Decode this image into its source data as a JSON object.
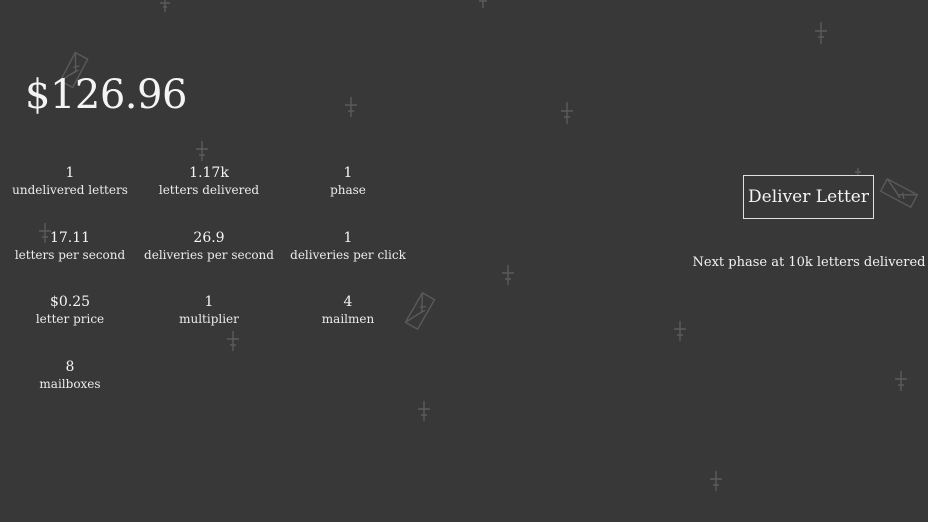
{
  "money": "$126.96",
  "stats": [
    {
      "value": "1",
      "label": "undelivered letters"
    },
    {
      "value": "1.17k",
      "label": "letters delivered"
    },
    {
      "value": "1",
      "label": "phase"
    },
    {
      "value": "17.11",
      "label": "letters per second"
    },
    {
      "value": "26.9",
      "label": "deliveries per second"
    },
    {
      "value": "1",
      "label": "deliveries per click"
    },
    {
      "value": "$0.25",
      "label": "letter price"
    },
    {
      "value": "1",
      "label": "multiplier"
    },
    {
      "value": "4",
      "label": "mailmen"
    },
    {
      "value": "8",
      "label": "mailboxes"
    }
  ],
  "deliver_button": {
    "label": "Deliver Letter"
  },
  "next_phase_text": "Next phase at 10k letters delivered",
  "colors": {
    "background": "#383838",
    "text": "#f2f2f2",
    "decoration": "#5a5a5a"
  },
  "decorations": {
    "sparkle_icon": "dagger-sparkle-icon",
    "falling_icon": "falling-letter-icon"
  }
}
